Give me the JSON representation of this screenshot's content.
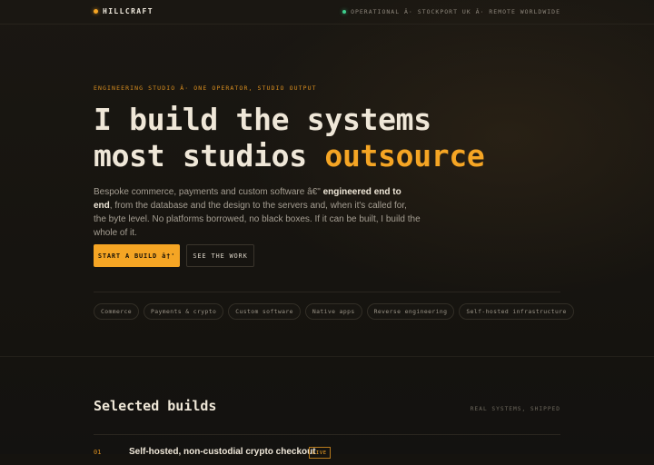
{
  "header": {
    "brand": "HILLCRAFT",
    "status": "OPERATIONAL Â· STOCKPORT UK Â· REMOTE WORLDWIDE"
  },
  "hero": {
    "eyebrow": "ENGINEERING STUDIO Â· ONE OPERATOR, STUDIO OUTPUT",
    "headline_line1": "I build the systems",
    "headline_line2_plain": "most studios ",
    "headline_line2_accent": "outsource",
    "lede_part1": "Bespoke commerce, payments and custom software â€\" ",
    "lede_strong": "engineered end to end",
    "lede_part2": ", from the database and the design to the servers and, when it's called for, the byte level. No platforms borrowed, no black boxes. If it can be built, I build the whole of it.",
    "primary_cta": "START A BUILD â†'",
    "secondary_cta": "SEE THE WORK"
  },
  "capabilities": [
    "Commerce",
    "Payments & crypto",
    "Custom software",
    "Native apps",
    "Reverse engineering",
    "Self-hosted infrastructure"
  ],
  "builds_section": {
    "title": "Selected builds",
    "meta": "REAL SYSTEMS, SHIPPED",
    "first_item": {
      "number": "01",
      "title": "Self-hosted, non-custodial crypto checkout",
      "badge": "LIVE"
    }
  },
  "colors": {
    "background": "#15130f",
    "accent": "#f5a524",
    "status_green": "#3ecf8e",
    "text_primary": "#efe7d8",
    "text_muted": "#a59e92"
  }
}
